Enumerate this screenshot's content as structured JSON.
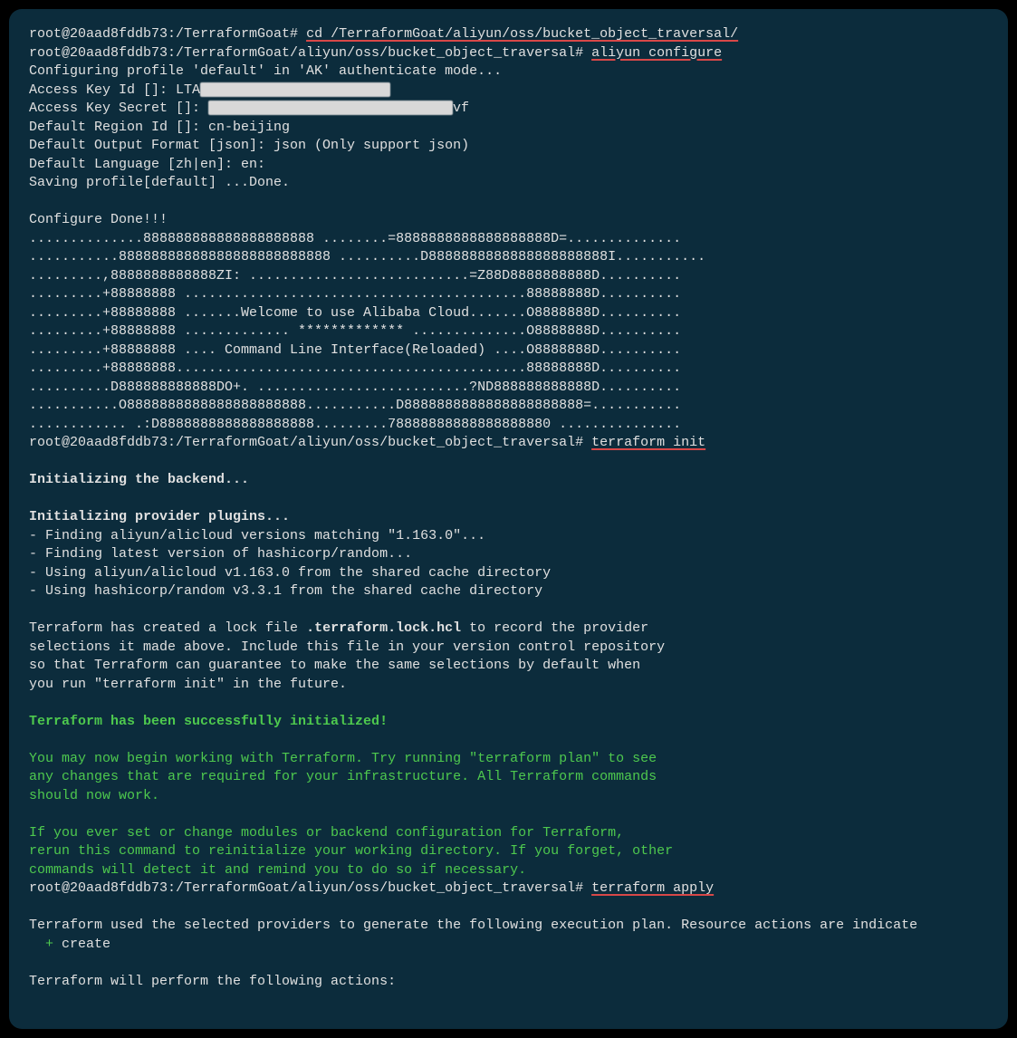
{
  "prompt1": "root@20aad8fddb73:/TerraformGoat# ",
  "cmd1": "cd /TerraformGoat/aliyun/oss/bucket_object_traversal/",
  "prompt2": "root@20aad8fddb73:/TerraformGoat/aliyun/oss/bucket_object_traversal# ",
  "cmd2": "aliyun configure",
  "cfg_line": "Configuring profile 'default' in 'AK' authenticate mode...",
  "ak_id_label": "Access Key Id []: LTA",
  "ak_secret_label": "Access Key Secret []: ",
  "ak_secret_tail": "vf",
  "region": "Default Region Id []: cn-beijing",
  "format": "Default Output Format [json]: json (Only support json)",
  "lang": "Default Language [zh|en]: en:",
  "saving": "Saving profile[default] ...Done.",
  "done": "Configure Done!!!",
  "art": {
    "l1": "..............888888888888888888888 ........=8888888888888888888D=..............",
    "l2": "...........88888888888888888888888888 ..........D8888888888888888888888I...........",
    "l3": ".........,8888888888888ZI: ...........................=Z88D8888888888D..........",
    "l4": ".........+88888888 ..........................................88888888D..........",
    "l5": ".........+88888888 .......Welcome to use Alibaba Cloud.......O8888888D..........",
    "l6": ".........+88888888 ............. ************* ..............O8888888D..........",
    "l7": ".........+88888888 .... Command Line Interface(Reloaded) ....O8888888D..........",
    "l8": ".........+88888888...........................................88888888D..........",
    "l9": "..........D888888888888DO+. ..........................?ND888888888888D..........",
    "l10": "...........O8888888888888888888888...........D8888888888888888888888=...........",
    "l11": "............ .:D8888888888888888888.........78888888888888888880 ..............."
  },
  "prompt3": "root@20aad8fddb73:/TerraformGoat/aliyun/oss/bucket_object_traversal# ",
  "cmd3": "terraform init",
  "init_backend": "Initializing the backend...",
  "init_plugins": "Initializing provider plugins...",
  "finding1": "- Finding aliyun/alicloud versions matching \"1.163.0\"...",
  "finding2": "- Finding latest version of hashicorp/random...",
  "using1": "- Using aliyun/alicloud v1.163.0 from the shared cache directory",
  "using2": "- Using hashicorp/random v3.3.1 from the shared cache directory",
  "lock1": "Terraform has created a lock file ",
  "lock1b": ".terraform.lock.hcl",
  "lock1c": " to record the provider",
  "lock2": "selections it made above. Include this file in your version control repository",
  "lock3": "so that Terraform can guarantee to make the same selections by default when",
  "lock4": "you run \"terraform init\" in the future.",
  "success": "Terraform has been successfully initialized!",
  "g1": "You may now begin working with Terraform. Try running \"terraform plan\" to see",
  "g2": "any changes that are required for your infrastructure. All Terraform commands",
  "g3": "should now work.",
  "g4": "If you ever set or change modules or backend configuration for Terraform,",
  "g5": "rerun this command to reinitialize your working directory. If you forget, other",
  "g6": "commands will detect it and remind you to do so if necessary.",
  "prompt4": "root@20aad8fddb73:/TerraformGoat/aliyun/oss/bucket_object_traversal# ",
  "cmd4": "terraform apply",
  "apply1": "Terraform used the selected providers to generate the following execution plan. Resource actions are indicate",
  "apply2a": "  + ",
  "apply2b": "create",
  "apply3": "Terraform will perform the following actions:"
}
